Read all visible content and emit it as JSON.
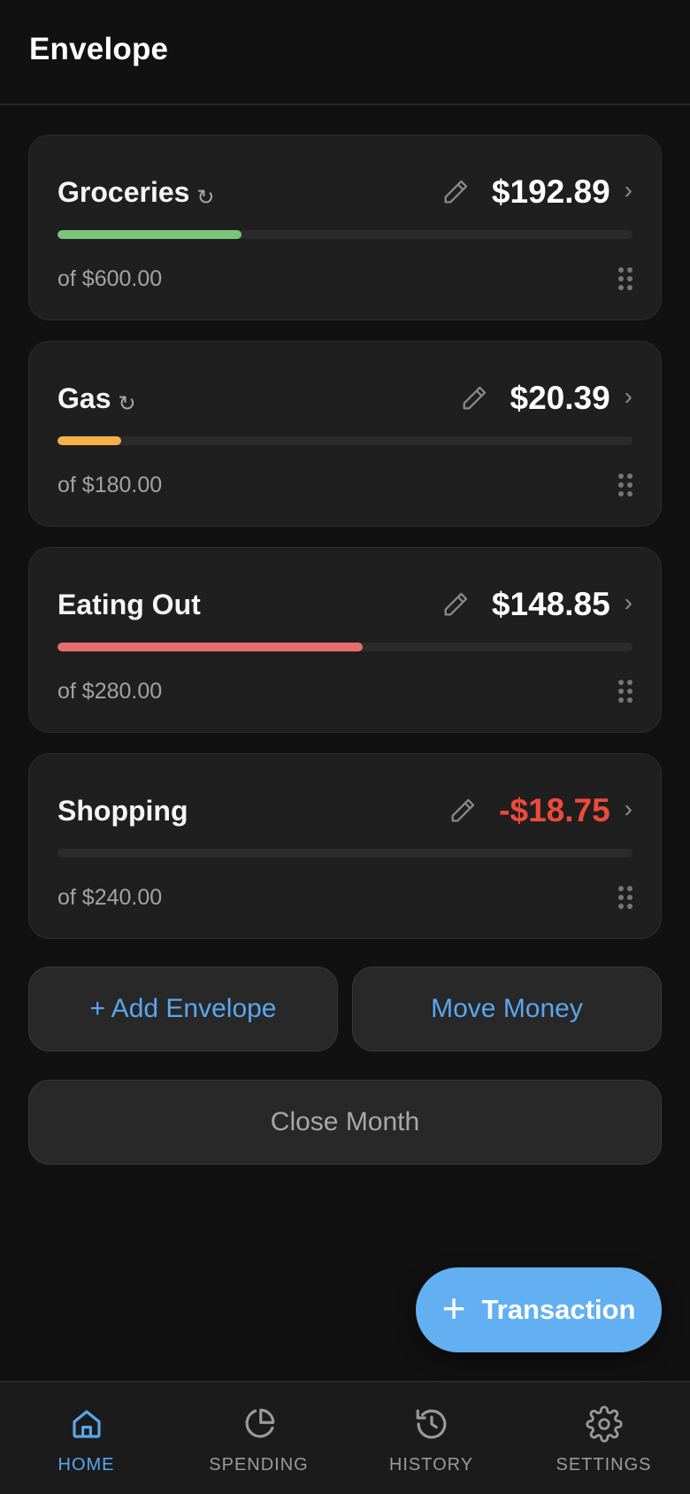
{
  "header": {
    "title": "Envelope"
  },
  "envelopes": [
    {
      "name": "Groceries",
      "recurring_icon": "↻",
      "amount": "$192.89",
      "budget_text": "of $600.00",
      "progress": 0.32,
      "bar_color": "#7cc47c",
      "negative": false
    },
    {
      "name": "Gas",
      "recurring_icon": "↻",
      "amount": "$20.39",
      "budget_text": "of $180.00",
      "progress": 0.11,
      "bar_color": "#f5b04a",
      "negative": false
    },
    {
      "name": "Eating Out",
      "recurring_icon": "",
      "amount": "$148.85",
      "budget_text": "of $280.00",
      "progress": 0.53,
      "bar_color": "#e86e6e",
      "negative": false
    },
    {
      "name": "Shopping",
      "recurring_icon": "",
      "amount": "-$18.75",
      "budget_text": "of $240.00",
      "progress": 0,
      "bar_color": "#e86e6e",
      "negative": true
    }
  ],
  "actions": {
    "add_envelope": "+ Add Envelope",
    "move_money": "Move Money",
    "close_month": "Close Month"
  },
  "fab": {
    "plus": "+",
    "label": "Transaction"
  },
  "nav": [
    {
      "label": "HOME",
      "icon": "home-icon",
      "active": true
    },
    {
      "label": "SPENDING",
      "icon": "pie-chart-icon",
      "active": false
    },
    {
      "label": "HISTORY",
      "icon": "history-icon",
      "active": false
    },
    {
      "label": "SETTINGS",
      "icon": "gear-icon",
      "active": false
    }
  ],
  "colors": {
    "accent": "#5aa7ee",
    "negative": "#ef4a3b",
    "fab": "#62b0f2"
  }
}
